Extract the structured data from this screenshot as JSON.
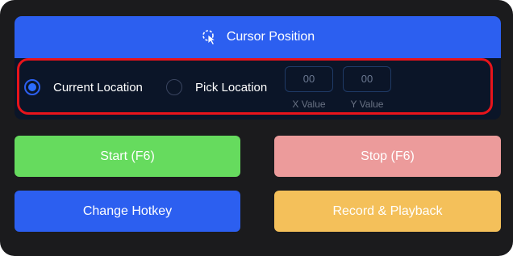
{
  "panel": {
    "title": "Cursor Position",
    "icon": "cursor-target-icon"
  },
  "options": [
    {
      "label": "Current Location",
      "selected": true
    },
    {
      "label": "Pick Location",
      "selected": false
    }
  ],
  "coords": {
    "x": {
      "value": "00",
      "label": "X Value"
    },
    "y": {
      "value": "00",
      "label": "Y Value"
    }
  },
  "buttons": {
    "start": {
      "label": "Start (F6)",
      "color": "#66db5e"
    },
    "stop": {
      "label": "Stop (F6)",
      "color": "#ec9b9b"
    },
    "hotkey": {
      "label": "Change Hotkey",
      "color": "#2c5ff0"
    },
    "record": {
      "label": "Record & Playback",
      "color": "#f4c05a"
    }
  },
  "colors": {
    "accent": "#2c5ff0",
    "panel_bg": "#0b1528",
    "window_bg": "#1b1b1d",
    "highlight": "#e8141b"
  }
}
